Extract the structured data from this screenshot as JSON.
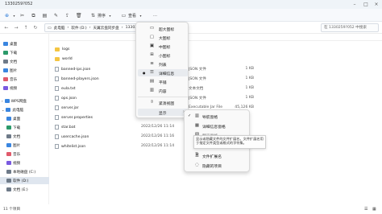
{
  "window": {
    "title": "1330259?052"
  },
  "toolbar": {
    "cut_label": "",
    "sort_label": "排序",
    "view_label": "查看",
    "more_label": "…"
  },
  "address": {
    "segments": [
      "此电脑",
      "软件 (D:)",
      "天翼云盘同步盘",
      "133025…"
    ],
    "search_placeholder": "在 1330259?052 中搜索"
  },
  "sidebar": {
    "items": [
      {
        "label": "桌面",
        "color": "#3a86e0"
      },
      {
        "label": "下载",
        "color": "#2b9a6a"
      },
      {
        "label": "文档",
        "color": "#6e7a88"
      },
      {
        "label": "图片",
        "color": "#3a86e0"
      },
      {
        "label": "音乐",
        "color": "#e05a6b"
      },
      {
        "label": "视频",
        "color": "#7a5ae0"
      },
      {
        "label": "WPS网盘",
        "color": "#3a86e0"
      },
      {
        "label": "此电脑",
        "color": "#3a86e0"
      },
      {
        "label": "桌面",
        "color": "#3a86e0"
      },
      {
        "label": "下载",
        "color": "#2b9a6a"
      },
      {
        "label": "文档",
        "color": "#6e7a88"
      },
      {
        "label": "图片",
        "color": "#3a86e0"
      },
      {
        "label": "音乐",
        "color": "#e05a6b"
      },
      {
        "label": "视频",
        "color": "#7a5ae0"
      },
      {
        "label": "本地磁盘 (C:)",
        "color": "#6e7a88"
      },
      {
        "label": "软件 (D:)",
        "color": "#6e7a88"
      },
      {
        "label": "文档 (E:)",
        "color": "#6e7a88"
      }
    ]
  },
  "files": [
    {
      "name": "logs",
      "kind": "folder",
      "date": "",
      "type": "",
      "size": ""
    },
    {
      "name": "world",
      "kind": "folder",
      "date": "",
      "type": "",
      "size": ""
    },
    {
      "name": "banned-ips.json",
      "kind": "file",
      "date": "",
      "type": "JSON 文件",
      "size": "1 KB"
    },
    {
      "name": "banned-players.json",
      "kind": "file",
      "date": "",
      "type": "JSON 文件",
      "size": "1 KB"
    },
    {
      "name": "eula.txt",
      "kind": "file",
      "date": "",
      "type": "文本文档",
      "size": "1 KB"
    },
    {
      "name": "ops.json",
      "kind": "file",
      "date": "",
      "type": "JSON 文件",
      "size": "1 KB"
    },
    {
      "name": "server.jar",
      "kind": "file",
      "date": "",
      "type": "Executable Jar File",
      "size": "45,126 KB"
    },
    {
      "name": "server.properties",
      "kind": "file",
      "date": "",
      "type": "",
      "size": ""
    },
    {
      "name": "star.bat",
      "kind": "file",
      "date": "2022/12/26 11:14",
      "type": "",
      "size": ""
    },
    {
      "name": "usercache.json",
      "kind": "file",
      "date": "2022/12/26 11:16",
      "type": "",
      "size": ""
    },
    {
      "name": "whitelist.json",
      "kind": "file",
      "date": "2022/12/26 11:14",
      "type": "",
      "size": ""
    }
  ],
  "status": {
    "count": "11 个项目"
  },
  "view_menu": {
    "items": [
      {
        "label": "超大图标",
        "icon": "monitor-icon"
      },
      {
        "label": "大图标",
        "icon": "large-icons-icon"
      },
      {
        "label": "中图标",
        "icon": "medium-icons-icon"
      },
      {
        "label": "小图标",
        "icon": "small-icons-icon"
      },
      {
        "label": "列表",
        "icon": "list-icon"
      },
      {
        "label": "详细信息",
        "icon": "details-icon",
        "selected": true
      },
      {
        "label": "平铺",
        "icon": "tiles-icon"
      },
      {
        "label": "内容",
        "icon": "content-icon"
      },
      {
        "label": "紧凑视图",
        "icon": "compact-view-icon"
      },
      {
        "label": "显示",
        "icon": "show-icon",
        "has_submenu": true
      }
    ]
  },
  "show_submenu": {
    "items": [
      {
        "label": "导航窗格",
        "icon": "navigation-pane-icon",
        "checked": true
      },
      {
        "label": "详细信息窗格",
        "icon": "details-pane-icon"
      },
      {
        "label": "预览窗格",
        "icon": "preview-pane-icon"
      },
      {
        "label": "文件扩展名",
        "icon": "file-extension-icon"
      },
      {
        "label": "隐藏的项目",
        "icon": "hidden-items-icon"
      }
    ]
  },
  "tooltip": {
    "text": "显示或隐藏文件的文件扩展名。文件扩展名用于指定文件类型或格式的字符集。"
  }
}
